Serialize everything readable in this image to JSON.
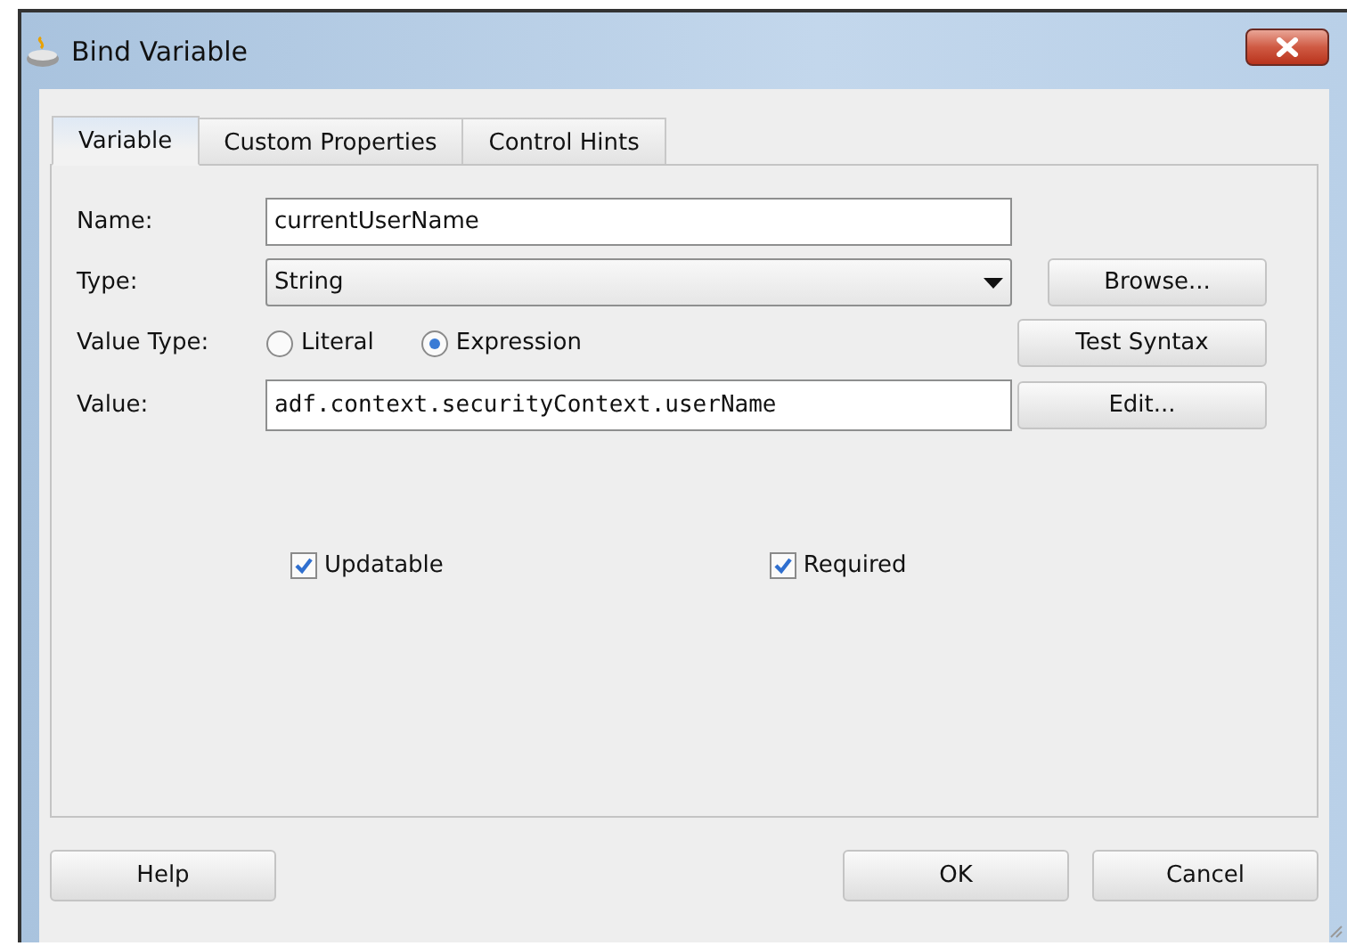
{
  "window": {
    "title": "Bind Variable"
  },
  "tabs": [
    {
      "label": "Variable",
      "selected": true
    },
    {
      "label": "Custom Properties",
      "selected": false
    },
    {
      "label": "Control Hints",
      "selected": false
    }
  ],
  "fields": [
    {
      "kind": "text",
      "label": "Name:",
      "value": "currentUserName"
    },
    {
      "kind": "dropdown",
      "label": "Type:",
      "value": "String",
      "button": {
        "label": "Browse..."
      }
    },
    {
      "kind": "radio",
      "label": "Value Type:",
      "options": [
        {
          "label": "Literal",
          "selected": false
        },
        {
          "label": "Expression",
          "selected": true
        }
      ],
      "button": {
        "label": "Test Syntax"
      }
    },
    {
      "kind": "code",
      "label": "Value:",
      "value": "adf.context.securityContext.userName",
      "button": {
        "label": "Edit..."
      }
    }
  ],
  "checkboxes": [
    {
      "label": "Updatable",
      "checked": true
    },
    {
      "label": "Required",
      "checked": true
    }
  ],
  "buttons": [
    {
      "label": "Help"
    },
    {
      "label": "OK"
    },
    {
      "label": "Cancel"
    }
  ]
}
